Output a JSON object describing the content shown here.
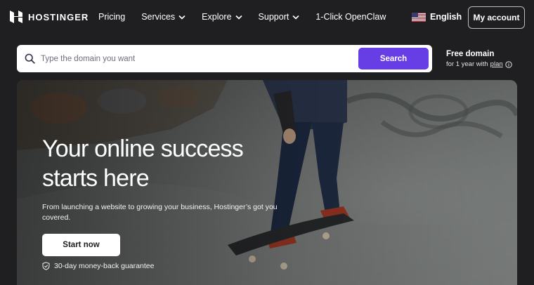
{
  "brand": {
    "name": "HOSTINGER"
  },
  "nav": {
    "items": [
      {
        "label": "Pricing",
        "has_dropdown": false
      },
      {
        "label": "Services",
        "has_dropdown": true
      },
      {
        "label": "Explore",
        "has_dropdown": true
      },
      {
        "label": "Support",
        "has_dropdown": true
      },
      {
        "label": "1-Click OpenClaw",
        "has_dropdown": false
      }
    ],
    "language": {
      "label": "English",
      "flag_icon": "us-flag-icon"
    },
    "account_button": "My account"
  },
  "search": {
    "placeholder": "Type the domain you want",
    "value": "",
    "button_label": "Search",
    "icon": "search-icon"
  },
  "free_domain": {
    "title": "Free domain",
    "subtitle_prefix": "for 1 year with",
    "plan_link": "plan",
    "icon": "info-icon"
  },
  "hero": {
    "title_line1": "Your online success",
    "title_line2": "starts here",
    "subtitle": "From launching a website to growing your business, Hostinger’s got you covered.",
    "cta_label": "Start now",
    "guarantee": "30-day money-back guarantee",
    "guarantee_icon": "shield-check-icon"
  },
  "colors": {
    "page_background": "#1f1f22",
    "accent": "#673de6",
    "text_primary": "#ffffff",
    "hero_overlay": "#4e5250"
  }
}
